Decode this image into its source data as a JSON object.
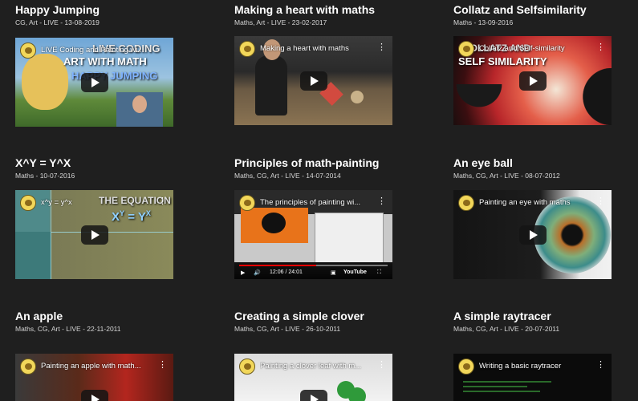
{
  "videos": [
    {
      "title": "Happy Jumping",
      "meta": "CG, Art - LIVE - 13-08-2019",
      "video_title": "LIVE Coding and Painting wi...",
      "overlay": [
        "LIVE CODING",
        "ART WITH MATH",
        "HAPPY JUMPING"
      ]
    },
    {
      "title": "Making a heart with maths",
      "meta": "Maths, Art - LIVE - 23-02-2017",
      "video_title": "Making a heart with maths",
      "overlay": []
    },
    {
      "title": "Collatz and Selfsimilarity",
      "meta": "Maths - 13-09-2016",
      "video_title": "Collatz and Self-similarity",
      "overlay": [
        "COLLATZ AND",
        "SELF SIMILARITY"
      ]
    },
    {
      "title": "X^Y = Y^X",
      "meta": "Maths - 10-07-2016",
      "video_title": "x^y = y^x",
      "overlay": [
        "THE EQUATION",
        "X",
        "Y",
        "=",
        "Y",
        "X"
      ]
    },
    {
      "title": "Principles of math-painting",
      "meta": "Maths, CG, Art - LIVE - 14-07-2014",
      "video_title": "The principles of painting wi...",
      "time": "12:06 / 24:01",
      "brand": "YouTube",
      "overlay": []
    },
    {
      "title": "An eye ball",
      "meta": "Maths, CG, Art - LIVE - 08-07-2012",
      "video_title": "Painting an eye with maths",
      "overlay": []
    },
    {
      "title": "An apple",
      "meta": "Maths, CG, Art - LIVE - 22-11-2011",
      "video_title": "Painting an apple with math...",
      "overlay": []
    },
    {
      "title": "Creating a simple clover",
      "meta": "Maths, CG, Art - LIVE - 26-10-2011",
      "video_title": "Painting a clover leaf with m...",
      "overlay": []
    },
    {
      "title": "A simple raytracer",
      "meta": "Maths, CG, Art - LIVE - 20-07-2011",
      "video_title": "Writing a basic raytracer",
      "overlay": []
    }
  ],
  "icons": {
    "play": "play-icon",
    "menu": "kebab-menu-icon",
    "channel": "channel-avatar-icon"
  }
}
